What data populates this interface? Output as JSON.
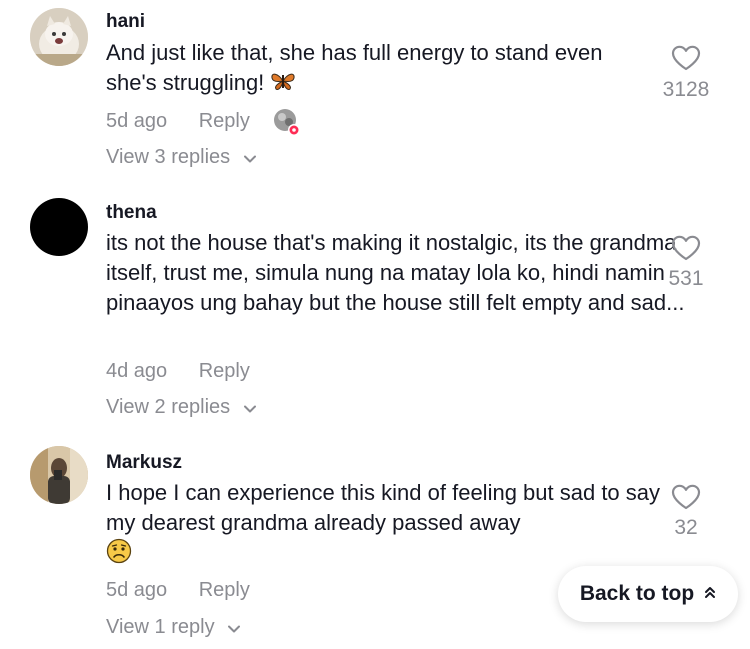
{
  "comments": [
    {
      "username": "hani",
      "text": "And just like that, she has full energy to stand even she's struggling!",
      "emoji": "butterfly-emoji",
      "time": "5d ago",
      "reply_label": "Reply",
      "view_replies": "View 3 replies",
      "likes": "3128",
      "has_liker_avatar": true
    },
    {
      "username": "thena",
      "text": "its not the house that's making it nostalgic, its the grandma itself, trust me, simula nung na matay lola ko, hindi namin pinaayos ung bahay but the house still felt empty and sad...",
      "time": "4d ago",
      "reply_label": "Reply",
      "view_replies": "View 2 replies",
      "likes": "531"
    },
    {
      "username": "Markusz",
      "text": "I hope I can experience this kind of feeling but sad to say my dearest grandma already passed away",
      "emoji": "sad-face-emoji",
      "time": "5d ago",
      "reply_label": "Reply",
      "view_replies": "View 1 reply",
      "likes": "32"
    }
  ],
  "back_to_top": {
    "label": "Back to top",
    "icon": "double-chevron-up-icon"
  },
  "colors": {
    "primary_text": "#161823",
    "secondary_text": "#8a8b91",
    "background": "#ffffff"
  }
}
